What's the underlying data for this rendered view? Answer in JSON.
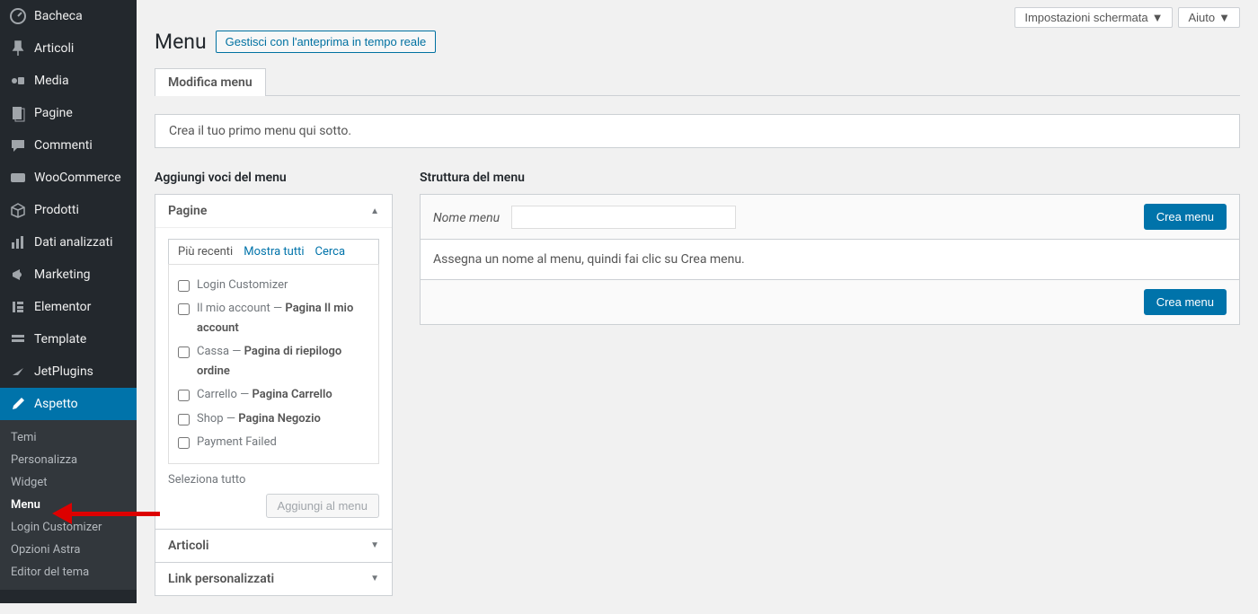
{
  "topbar": {
    "screen_options": "Impostazioni schermata",
    "help": "Aiuto"
  },
  "sidebar": {
    "items": [
      {
        "icon": "dashboard",
        "label": "Bacheca"
      },
      {
        "icon": "pin",
        "label": "Articoli"
      },
      {
        "icon": "media",
        "label": "Media"
      },
      {
        "icon": "page",
        "label": "Pagine"
      },
      {
        "icon": "comment",
        "label": "Commenti"
      },
      {
        "icon": "woo",
        "label": "WooCommerce"
      },
      {
        "icon": "box",
        "label": "Prodotti"
      },
      {
        "icon": "stats",
        "label": "Dati analizzati"
      },
      {
        "icon": "megaphone",
        "label": "Marketing"
      },
      {
        "icon": "elementor",
        "label": "Elementor"
      },
      {
        "icon": "template",
        "label": "Template"
      },
      {
        "icon": "jet",
        "label": "JetPlugins"
      },
      {
        "icon": "brush",
        "label": "Aspetto",
        "active": true
      }
    ],
    "sub": [
      {
        "label": "Temi"
      },
      {
        "label": "Personalizza"
      },
      {
        "label": "Widget"
      },
      {
        "label": "Menu",
        "current": true
      },
      {
        "label": "Login Customizer"
      },
      {
        "label": "Opzioni Astra"
      },
      {
        "label": "Editor del tema"
      }
    ]
  },
  "page": {
    "title": "Menu",
    "live_preview": "Gestisci con l'anteprima in tempo reale",
    "tab_label": "Modifica menu",
    "notice": "Crea il tuo primo menu qui sotto."
  },
  "left": {
    "title": "Aggiungi voci del menu",
    "acc_pages": "Pagine",
    "acc_posts": "Articoli",
    "acc_links": "Link personalizzati",
    "subtabs": {
      "recent": "Più recenti",
      "all": "Mostra tutti",
      "search": "Cerca"
    },
    "pages": [
      {
        "text": "Login Customizer"
      },
      {
        "text": "Il mio account — ",
        "bold": "Pagina Il mio account"
      },
      {
        "text": "Cassa — ",
        "bold": "Pagina di riepilogo ordine"
      },
      {
        "text": "Carrello — ",
        "bold": "Pagina Carrello"
      },
      {
        "text": "Shop — ",
        "bold": "Pagina Negozio"
      },
      {
        "text": "Payment Failed"
      }
    ],
    "select_all": "Seleziona tutto",
    "add_btn": "Aggiungi al menu"
  },
  "right": {
    "title": "Struttura del menu",
    "name_label": "Nome menu",
    "body_text": "Assegna un nome al menu, quindi fai clic su Crea menu.",
    "create_btn": "Crea menu"
  }
}
